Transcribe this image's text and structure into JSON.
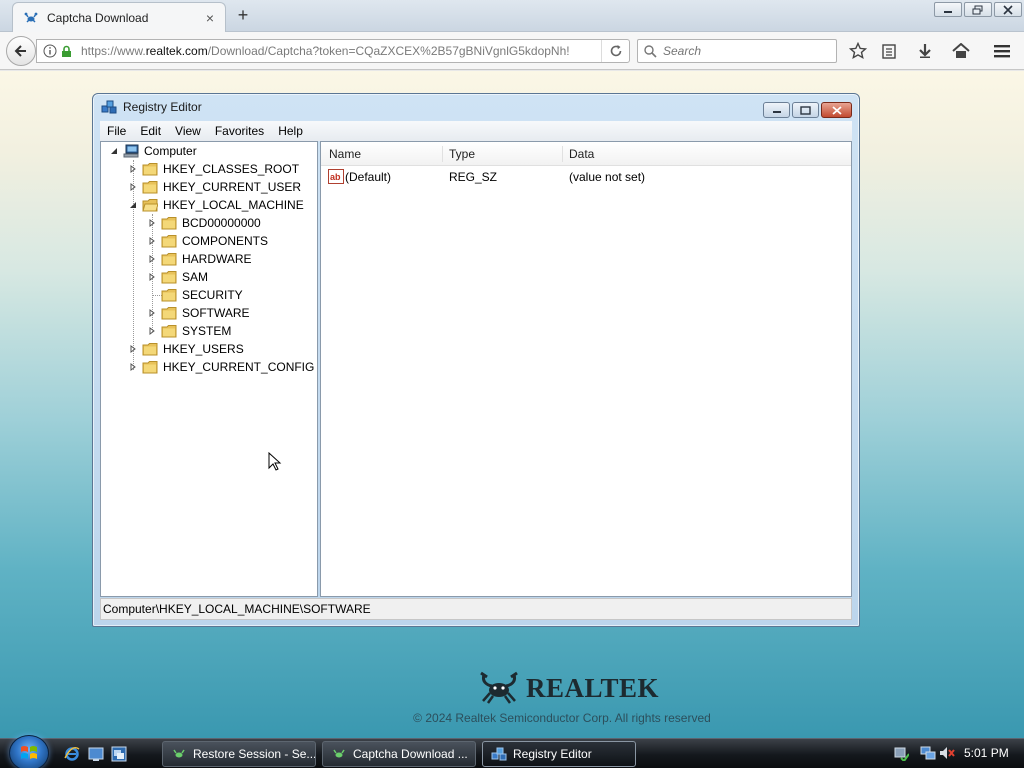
{
  "browser": {
    "tab_title": "Captcha Download",
    "url_prefix": "https://www.",
    "url_domain": "realtek.com",
    "url_rest": "/Download/Captcha?token=CQaZXCEX%2B57gBNiVgnlG5kdopNh!",
    "search_placeholder": "Search"
  },
  "page": {
    "brand": "REALTEK",
    "copyright": "© 2024 Realtek Semiconductor Corp. All rights reserved"
  },
  "regedit": {
    "title": "Registry Editor",
    "menu": [
      "File",
      "Edit",
      "View",
      "Favorites",
      "Help"
    ],
    "tree": {
      "root": "Computer",
      "hives": [
        "HKEY_CLASSES_ROOT",
        "HKEY_CURRENT_USER",
        "HKEY_LOCAL_MACHINE",
        "HKEY_USERS",
        "HKEY_CURRENT_CONFIG"
      ],
      "hklm_children": [
        "BCD00000000",
        "COMPONENTS",
        "HARDWARE",
        "SAM",
        "SECURITY",
        "SOFTWARE",
        "SYSTEM"
      ]
    },
    "columns": {
      "name": "Name",
      "type": "Type",
      "data": "Data"
    },
    "values": [
      {
        "name": "(Default)",
        "type": "REG_SZ",
        "data": "(value not set)"
      }
    ],
    "status_path": "Computer\\HKEY_LOCAL_MACHINE\\SOFTWARE"
  },
  "taskbar": {
    "buttons": [
      "Restore Session - Se...",
      "Captcha Download ...",
      "Registry Editor"
    ],
    "clock": "5:01 PM"
  }
}
